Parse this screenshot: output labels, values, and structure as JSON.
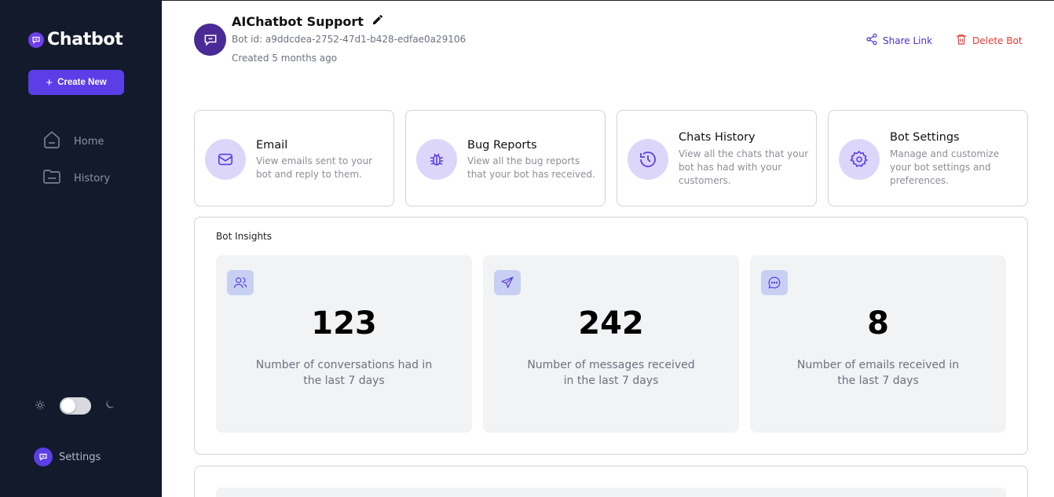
{
  "sidebar": {
    "logo_text": "Chatbot",
    "create_label": "Create New",
    "nav": [
      {
        "label": "Home",
        "icon": "home-icon"
      },
      {
        "label": "History",
        "icon": "history-folder-icon"
      }
    ],
    "settings_label": "Settings"
  },
  "header": {
    "bot_name": "AIChatbot Support",
    "bot_id": "Bot id: a9ddcdea-2752-47d1-b428-edfae0a29106",
    "created": "Created 5 months ago",
    "share_label": "Share Link",
    "delete_label": "Delete Bot"
  },
  "cards": [
    {
      "title": "Email",
      "desc": "View emails sent to your bot and reply to them.",
      "icon": "mail-icon"
    },
    {
      "title": "Bug Reports",
      "desc": "View all the bug reports that your bot has received.",
      "icon": "bug-icon"
    },
    {
      "title": "Chats History",
      "desc": "View all the chats that your bot has had with your customers.",
      "icon": "history-icon"
    },
    {
      "title": "Bot Settings",
      "desc": "Manage and customize your bot settings and preferences.",
      "icon": "gear-icon"
    }
  ],
  "insights": {
    "title": "Bot Insights",
    "stats": [
      {
        "value": "123",
        "label": "Number of conversations had in the last 7 days",
        "icon": "users-icon"
      },
      {
        "value": "242",
        "label": "Number of messages received in the last 7 days",
        "icon": "send-icon"
      },
      {
        "value": "8",
        "label": "Number of emails received in the last 7 days",
        "icon": "chat-bubble-icon"
      }
    ]
  },
  "colors": {
    "sidebar_bg": "#121a2c",
    "accent": "#5b3ee6",
    "danger": "#e53935",
    "icon_circle": "#ddd6fb",
    "stat_bg": "#f2f3f5"
  }
}
